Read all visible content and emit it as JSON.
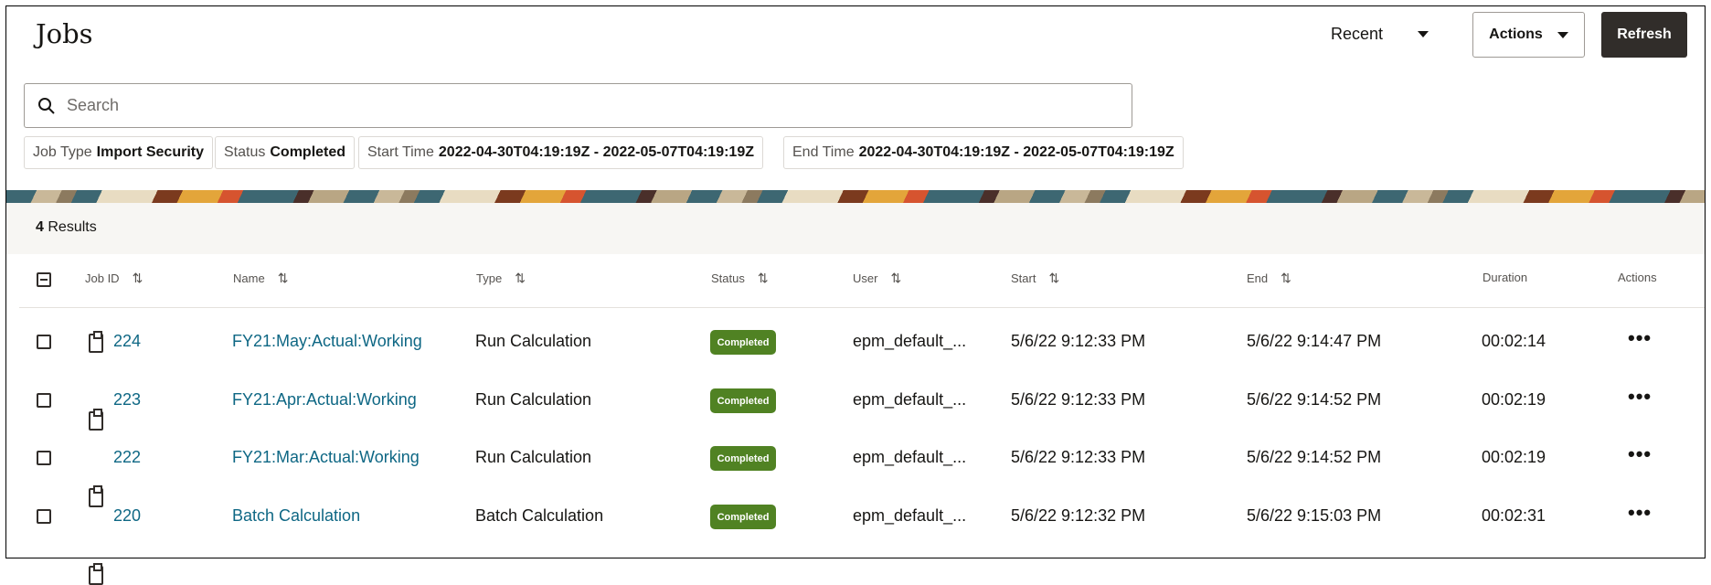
{
  "header": {
    "title": "Jobs",
    "recent_label": "Recent",
    "actions_label": "Actions",
    "refresh_label": "Refresh"
  },
  "search": {
    "placeholder": "Search",
    "value": ""
  },
  "filters": [
    {
      "label": "Job Type",
      "value": "Import Security"
    },
    {
      "label": "Status",
      "value": "Completed"
    },
    {
      "label": "Start Time",
      "value": "2022-04-30T04:19:19Z - 2022-05-07T04:19:19Z"
    },
    {
      "label": "End Time",
      "value": "2022-04-30T04:19:19Z - 2022-05-07T04:19:19Z"
    }
  ],
  "results": {
    "count": "4",
    "label": "Results"
  },
  "columns": {
    "job_id": "Job ID",
    "name": "Name",
    "type": "Type",
    "status": "Status",
    "user": "User",
    "start": "Start",
    "end": "End",
    "duration": "Duration",
    "actions": "Actions"
  },
  "rows": [
    {
      "id": "224",
      "name": "FY21:May:Actual:Working",
      "type": "Run Calculation",
      "status": "Completed",
      "user": "epm_default_...",
      "start": "5/6/22 9:12:33 PM",
      "end": "5/6/22 9:14:47 PM",
      "duration": "00:02:14"
    },
    {
      "id": "223",
      "name": "FY21:Apr:Actual:Working",
      "type": "Run Calculation",
      "status": "Completed",
      "user": "epm_default_...",
      "start": "5/6/22 9:12:33 PM",
      "end": "5/6/22 9:14:52 PM",
      "duration": "00:02:19"
    },
    {
      "id": "222",
      "name": "FY21:Mar:Actual:Working",
      "type": "Run Calculation",
      "status": "Completed",
      "user": "epm_default_...",
      "start": "5/6/22 9:12:33 PM",
      "end": "5/6/22 9:14:52 PM",
      "duration": "00:02:19"
    },
    {
      "id": "220",
      "name": "Batch Calculation",
      "type": "Batch Calculation",
      "status": "Completed",
      "user": "epm_default_...",
      "start": "5/6/22 9:12:32 PM",
      "end": "5/6/22 9:15:03 PM",
      "duration": "00:02:31"
    }
  ],
  "colors": {
    "link": "#0e6784",
    "badge": "#508223",
    "refresh_bg": "#312d2a"
  }
}
